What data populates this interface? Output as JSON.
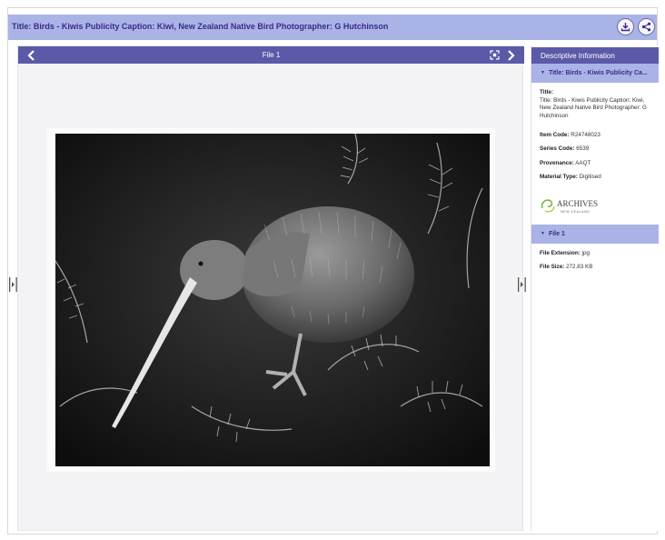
{
  "header": {
    "title": "Title: Birds - Kiwis Publicity Caption: Kiwi, New Zealand Native Bird Photographer: G Hutchinson",
    "download_icon": "download-icon",
    "share_icon": "share-icon"
  },
  "viewer": {
    "file_label": "File 1",
    "prev_icon": "chevron-left-icon",
    "next_icon": "chevron-right-icon",
    "fit_icon": "fit-screen-icon"
  },
  "panel": {
    "heading": "Descriptive Information",
    "section1_title": "Title: Birds - Kiwis Publicity Ca...",
    "title_label": "Title:",
    "title_value": "Title: Birds - Kiwis Publicity Caption: Kiwi, New Zealand Native Bird Photographer: G Hutchinson",
    "item_code_label": "Item Code:",
    "item_code_value": "R24748023",
    "series_code_label": "Series Code:",
    "series_code_value": "6539",
    "provenance_label": "Provenance:",
    "provenance_value": "AAQT",
    "material_type_label": "Material Type:",
    "material_type_value": "Digitised",
    "logo_word": "ARCHIVES",
    "logo_sub": "NEW ZEALAND",
    "section2_title": "File 1",
    "file_ext_label": "File Extension:",
    "file_ext_value": "jpg",
    "file_size_label": "File Size:",
    "file_size_value": "272.83 KB"
  },
  "colors": {
    "title_bar": "#aab3e6",
    "viewer_bar": "#5b5aa9",
    "title_text": "#3a2a86"
  }
}
